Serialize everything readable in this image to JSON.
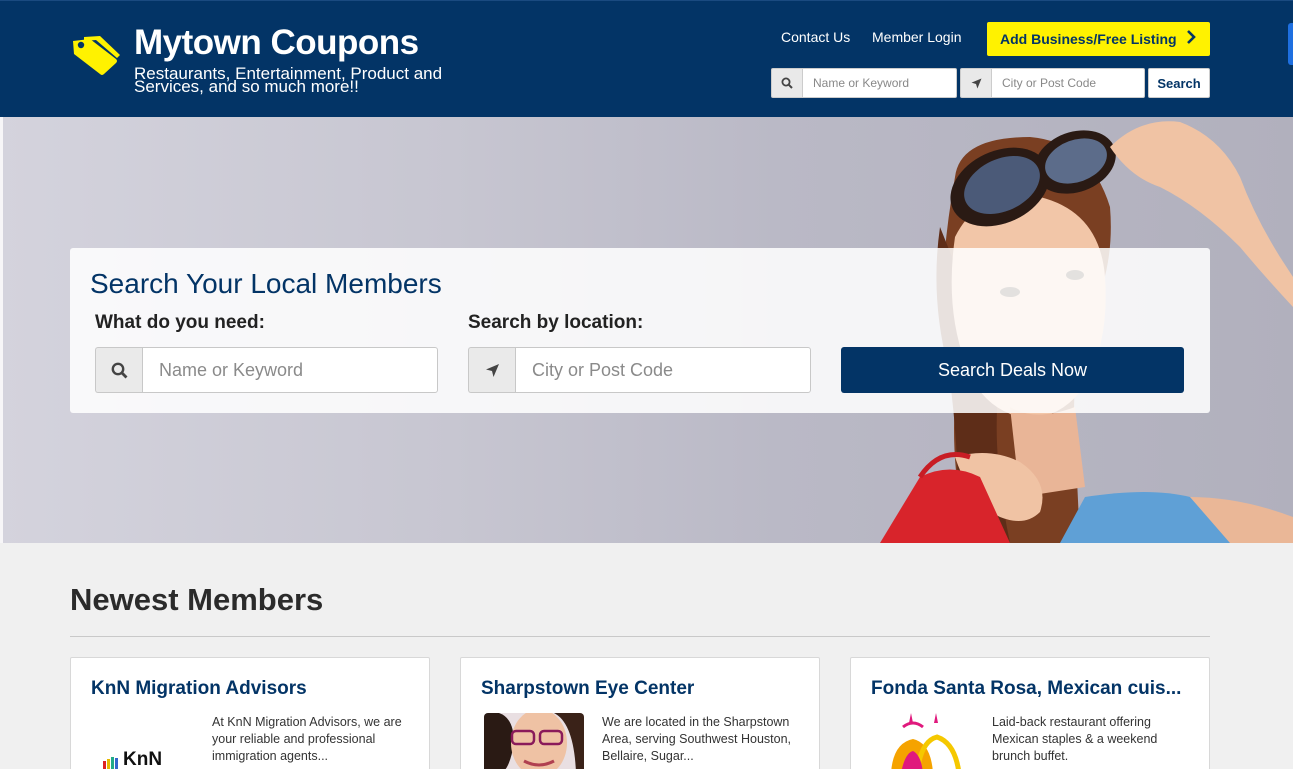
{
  "header": {
    "brand": "Mytown Coupons",
    "tagline": "Restaurants, Entertainment, Product and Services, and so much more!!",
    "nav": [
      {
        "label": "Contact Us"
      },
      {
        "label": "Member Login"
      }
    ],
    "add_button": "Add Business/Free Listing",
    "search": {
      "keyword_placeholder": "Name or Keyword",
      "location_placeholder": "City or Post Code",
      "button": "Search"
    }
  },
  "hero": {
    "panel_title": "Search Your Local Members",
    "need_label": "What do you need:",
    "need_placeholder": "Name or Keyword",
    "location_label": "Search by location:",
    "location_placeholder": "City or Post Code",
    "button": "Search Deals Now"
  },
  "newest": {
    "title": "Newest Members",
    "cards": [
      {
        "title": "KnN Migration Advisors",
        "desc": "At KnN Migration Advisors, we are your reliable and professional immigration agents...",
        "logo_text": "KnN"
      },
      {
        "title": "Sharpstown Eye Center",
        "desc": "We are located in the Sharpstown Area, serving Southwest Houston, Bellaire, Sugar..."
      },
      {
        "title": "Fonda Santa Rosa, Mexican cuis...",
        "desc": "Laid-back restaurant offering Mexican staples & a weekend brunch buffet."
      }
    ]
  },
  "colors": {
    "brand_navy": "#033466",
    "accent_yellow": "#fff200"
  }
}
